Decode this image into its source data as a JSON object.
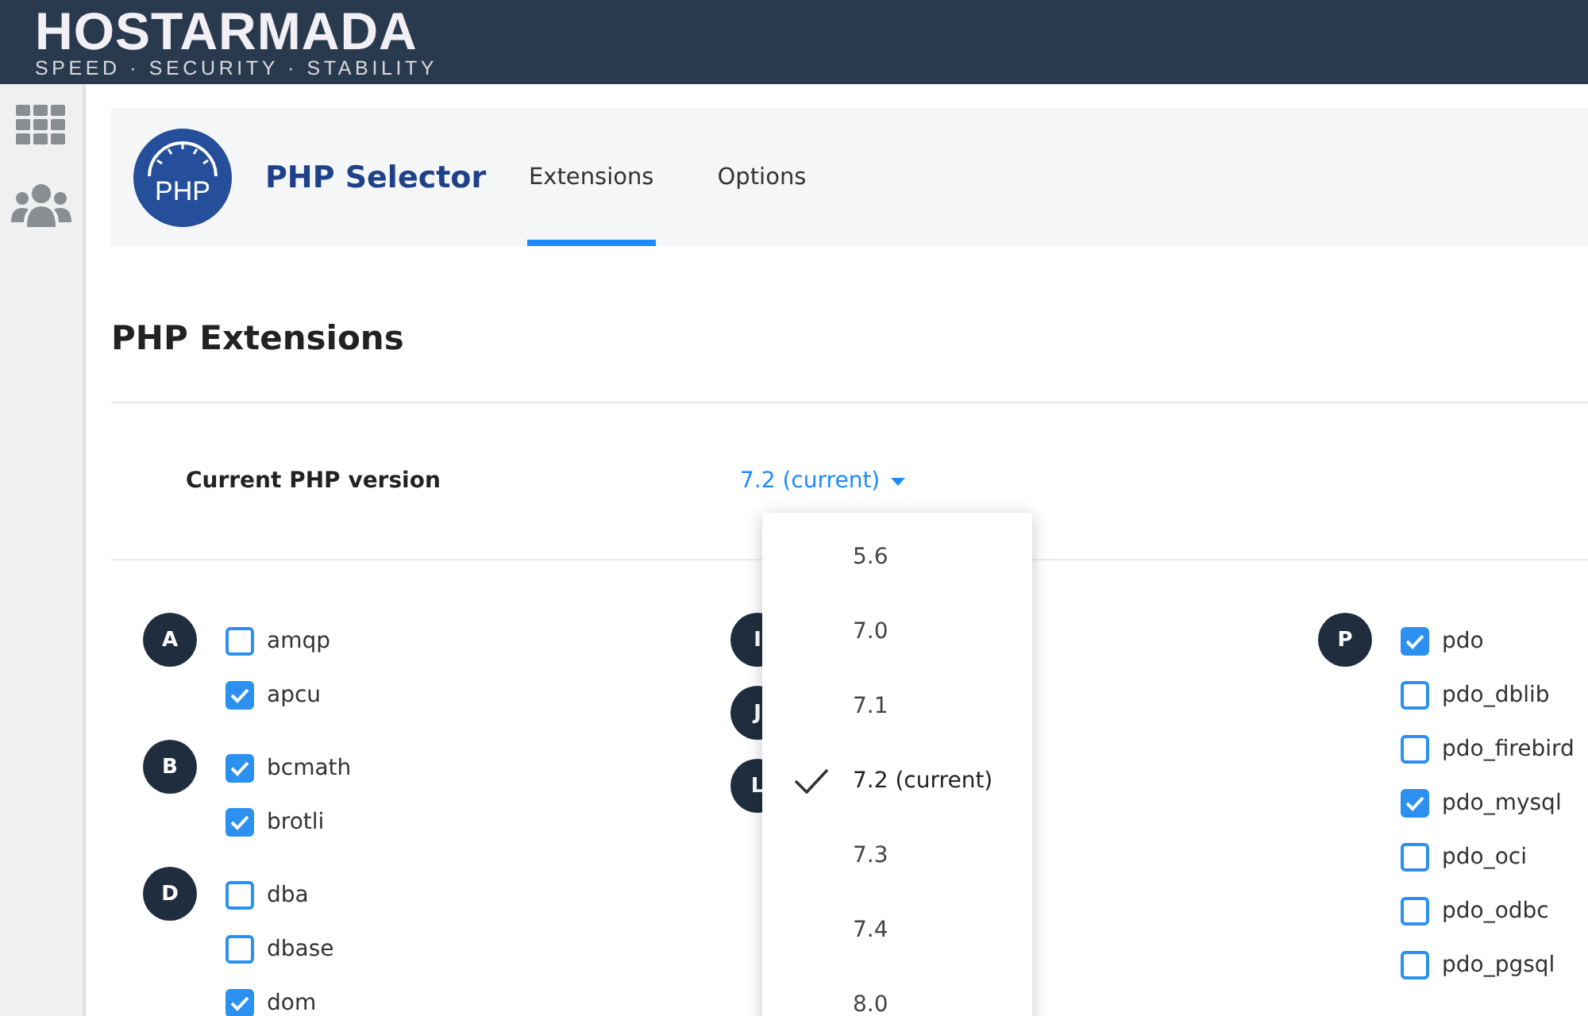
{
  "brand": {
    "name": "HOSTARMADA",
    "tagline": "SPEED · SECURITY · STABILITY"
  },
  "app": {
    "title": "PHP Selector",
    "icon_text": "PHP"
  },
  "tabs": [
    {
      "label": "Extensions",
      "selected": true
    },
    {
      "label": "Options",
      "selected": false
    }
  ],
  "heading": "PHP Extensions",
  "version": {
    "label": "Current PHP version",
    "value": "7.2 (current)",
    "options": [
      {
        "label": "5.6",
        "selected": false
      },
      {
        "label": "7.0",
        "selected": false
      },
      {
        "label": "7.1",
        "selected": false
      },
      {
        "label": "7.2 (current)",
        "selected": true
      },
      {
        "label": "7.3",
        "selected": false
      },
      {
        "label": "7.4",
        "selected": false
      },
      {
        "label": "8.0",
        "selected": false
      }
    ]
  },
  "columns": [
    {
      "groups": [
        {
          "letter": "A",
          "items": [
            {
              "name": "amqp",
              "checked": false
            },
            {
              "name": "apcu",
              "checked": true
            }
          ]
        },
        {
          "letter": "B",
          "items": [
            {
              "name": "bcmath",
              "checked": true
            },
            {
              "name": "brotli",
              "checked": true
            }
          ]
        },
        {
          "letter": "D",
          "items": [
            {
              "name": "dba",
              "checked": false
            },
            {
              "name": "dbase",
              "checked": false
            },
            {
              "name": "dom",
              "checked": true
            }
          ]
        }
      ]
    },
    {
      "groups": [
        {
          "letter": "I"
        },
        {
          "letter": "J"
        },
        {
          "letter": "L"
        }
      ]
    },
    {
      "groups": [
        {
          "letter": "P",
          "items": [
            {
              "name": "pdo",
              "checked": true
            },
            {
              "name": "pdo_dblib",
              "checked": false
            },
            {
              "name": "pdo_firebird",
              "checked": false
            },
            {
              "name": "pdo_mysql",
              "checked": true
            },
            {
              "name": "pdo_oci",
              "checked": false
            },
            {
              "name": "pdo_odbc",
              "checked": false
            },
            {
              "name": "pdo_pgsql",
              "checked": false
            }
          ]
        }
      ]
    }
  ]
}
